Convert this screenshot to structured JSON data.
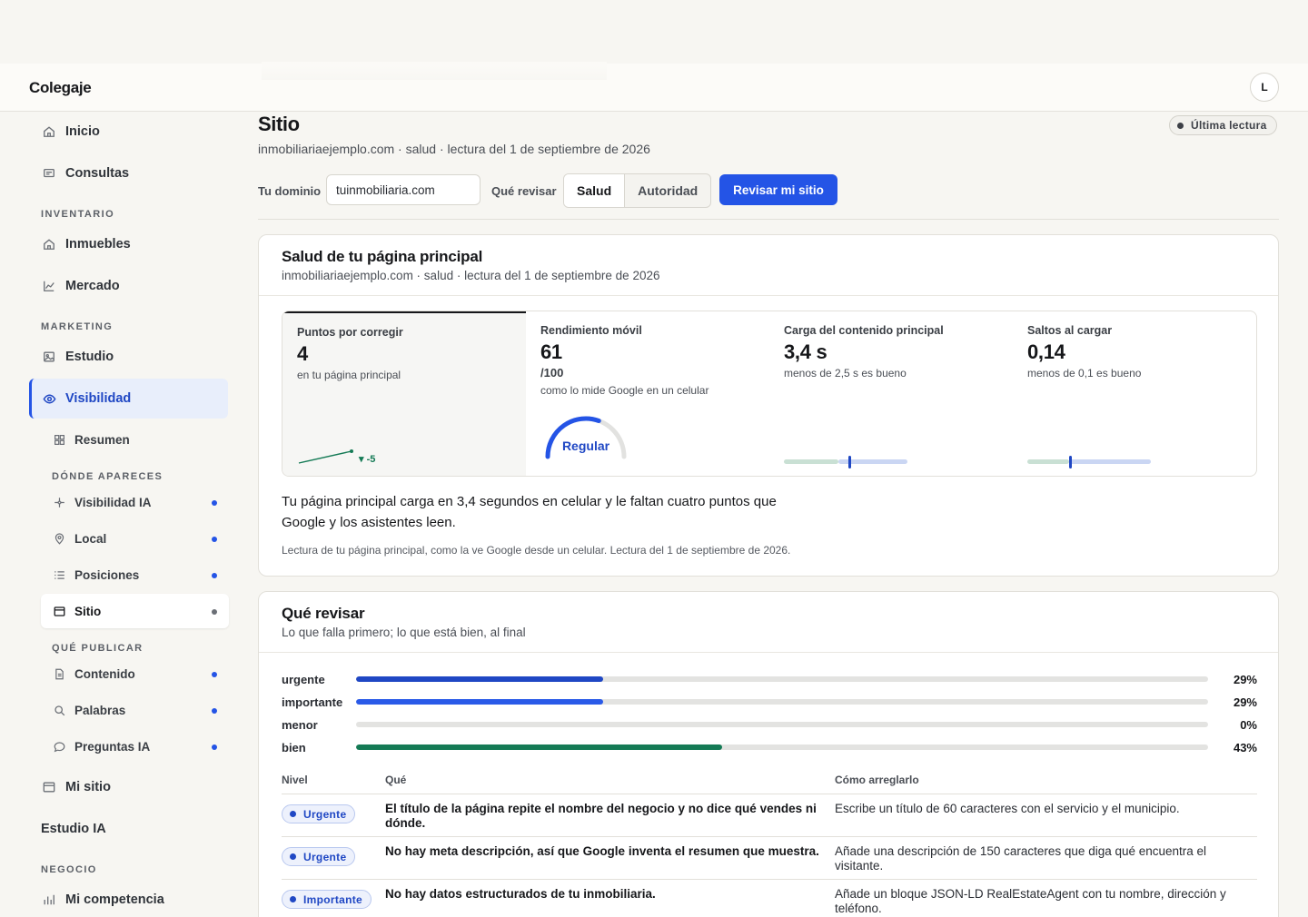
{
  "app": {
    "brand": "Colegaje",
    "avatar_initial": "L"
  },
  "sidebar": {
    "items": [
      {
        "label": "Inicio",
        "icon": "home-icon"
      },
      {
        "label": "Consultas",
        "icon": "inbox-icon"
      }
    ],
    "inventario_title": "INVENTARIO",
    "inventario_items": [
      {
        "label": "Inmuebles",
        "icon": "home-icon"
      },
      {
        "label": "Mercado",
        "icon": "chart-icon"
      }
    ],
    "marketing_title": "MARKETING",
    "marketing_items": [
      {
        "label": "Estudio",
        "icon": "image-icon"
      },
      {
        "label": "Visibilidad",
        "icon": "eye-icon"
      }
    ],
    "visibilidad_sub": {
      "label": "Resumen",
      "icon": "grid-icon"
    },
    "donde_title": "DÓNDE APARECES",
    "donde_items": [
      {
        "label": "Visibilidad IA",
        "icon": "sparkle-icon"
      },
      {
        "label": "Local",
        "icon": "pin-icon"
      },
      {
        "label": "Posiciones",
        "icon": "list-icon"
      },
      {
        "label": "Sitio",
        "icon": "window-icon"
      }
    ],
    "que_title": "QUÉ PUBLICAR",
    "que_items": [
      {
        "label": "Contenido",
        "icon": "document-icon"
      },
      {
        "label": "Palabras",
        "icon": "search-icon"
      },
      {
        "label": "Preguntas IA",
        "icon": "chat-icon"
      }
    ],
    "mi_sitio": {
      "label": "Mi sitio",
      "icon": "window-icon"
    },
    "estudio_ia": "Estudio IA",
    "negocio_title": "NEGOCIO",
    "negocio_items": [
      {
        "label": "Mi competencia",
        "icon": "bars-icon"
      }
    ]
  },
  "page": {
    "title": "Sitio",
    "subtitle": "inmobiliariaejemplo.com · salud · lectura del 1 de septiembre de 2026",
    "badge": "Última lectura",
    "domain_label": "Tu dominio",
    "domain_value": "tuinmobiliaria.com",
    "check_label": "Qué revisar",
    "segments": [
      "Salud",
      "Autoridad"
    ],
    "submit_label": "Revisar mi sitio"
  },
  "health": {
    "title": "Salud de tu página principal",
    "subtitle": "inmobiliariaejemplo.com · salud · lectura del 1 de septiembre de 2026",
    "metrics": [
      {
        "label": "Puntos por corregir",
        "value": "4",
        "note": "en tu página principal",
        "delta": "▾ -5"
      },
      {
        "label": "Rendimiento móvil",
        "value": "61",
        "unit": "/100",
        "note": "como lo mide Google en un celular",
        "gauge_label": "Regular",
        "gauge_value": 61
      },
      {
        "label": "Carga del contenido principal",
        "value": "3,4 s",
        "note": "menos de 2,5 s es bueno"
      },
      {
        "label": "Saltos al cargar",
        "value": "0,14",
        "note": "menos de 0,1 es bueno"
      }
    ],
    "summary": "Tu página principal carga en 3,4 segundos en celular y le faltan cuatro puntos que Google y los asistentes leen.",
    "caption": "Lectura de tu página principal, como la ve Google desde un celular. Lectura del 1 de septiembre de 2026."
  },
  "review": {
    "title": "Qué revisar",
    "subtitle": "Lo que falla primero; lo que está bien, al final",
    "bars": [
      {
        "label": "urgente",
        "pct": "29%",
        "value": 29,
        "color": "#1f47c4"
      },
      {
        "label": "importante",
        "pct": "29%",
        "value": 29,
        "color": "#2a5ae8"
      },
      {
        "label": "menor",
        "pct": "0%",
        "value": 0,
        "color": "#2a5ae8"
      },
      {
        "label": "bien",
        "pct": "43%",
        "value": 43,
        "color": "#147a55"
      }
    ],
    "columns": [
      "Nivel",
      "Qué",
      "Cómo arreglarlo"
    ],
    "rows": [
      {
        "level": "Urgente",
        "what": "El título de la página repite el nombre del negocio y no dice qué vendes ni dónde.",
        "fix": "Escribe un título de 60 caracteres con el servicio y el municipio."
      },
      {
        "level": "Urgente",
        "what": "No hay meta descripción, así que Google inventa el resumen que muestra.",
        "fix": "Añade una descripción de 150 caracteres que diga qué encuentra el visitante."
      },
      {
        "level": "Importante",
        "what": "No hay datos estructurados de tu inmobiliaria.",
        "fix": "Añade un bloque JSON-LD RealEstateAgent con tu nombre, dirección y teléfono."
      }
    ]
  }
}
